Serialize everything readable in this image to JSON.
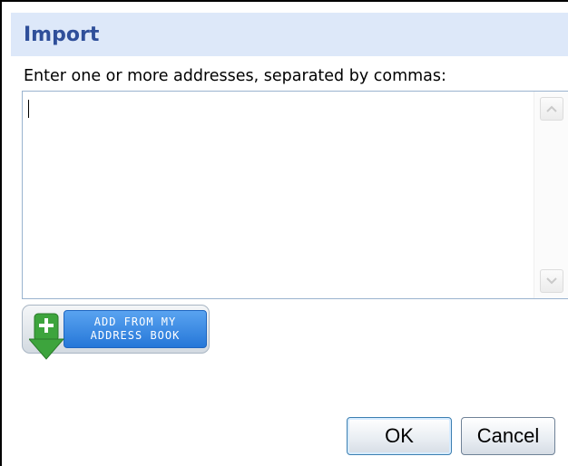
{
  "dialog": {
    "title": "Import",
    "prompt": "Enter one or more addresses, separated by commas:",
    "addresses_value": "",
    "add_from_address_book": {
      "line1": "ADD FROM MY",
      "line2": "ADDRESS BOOK",
      "icon": "plus-arrow-down-icon"
    },
    "ok_label": "OK",
    "cancel_label": "Cancel"
  },
  "colors": {
    "title_bar_bg": "#dde8f9",
    "title_text": "#2f4f9a",
    "address_book_button": "#2677d8",
    "plus_icon_green": "#3da43d"
  }
}
